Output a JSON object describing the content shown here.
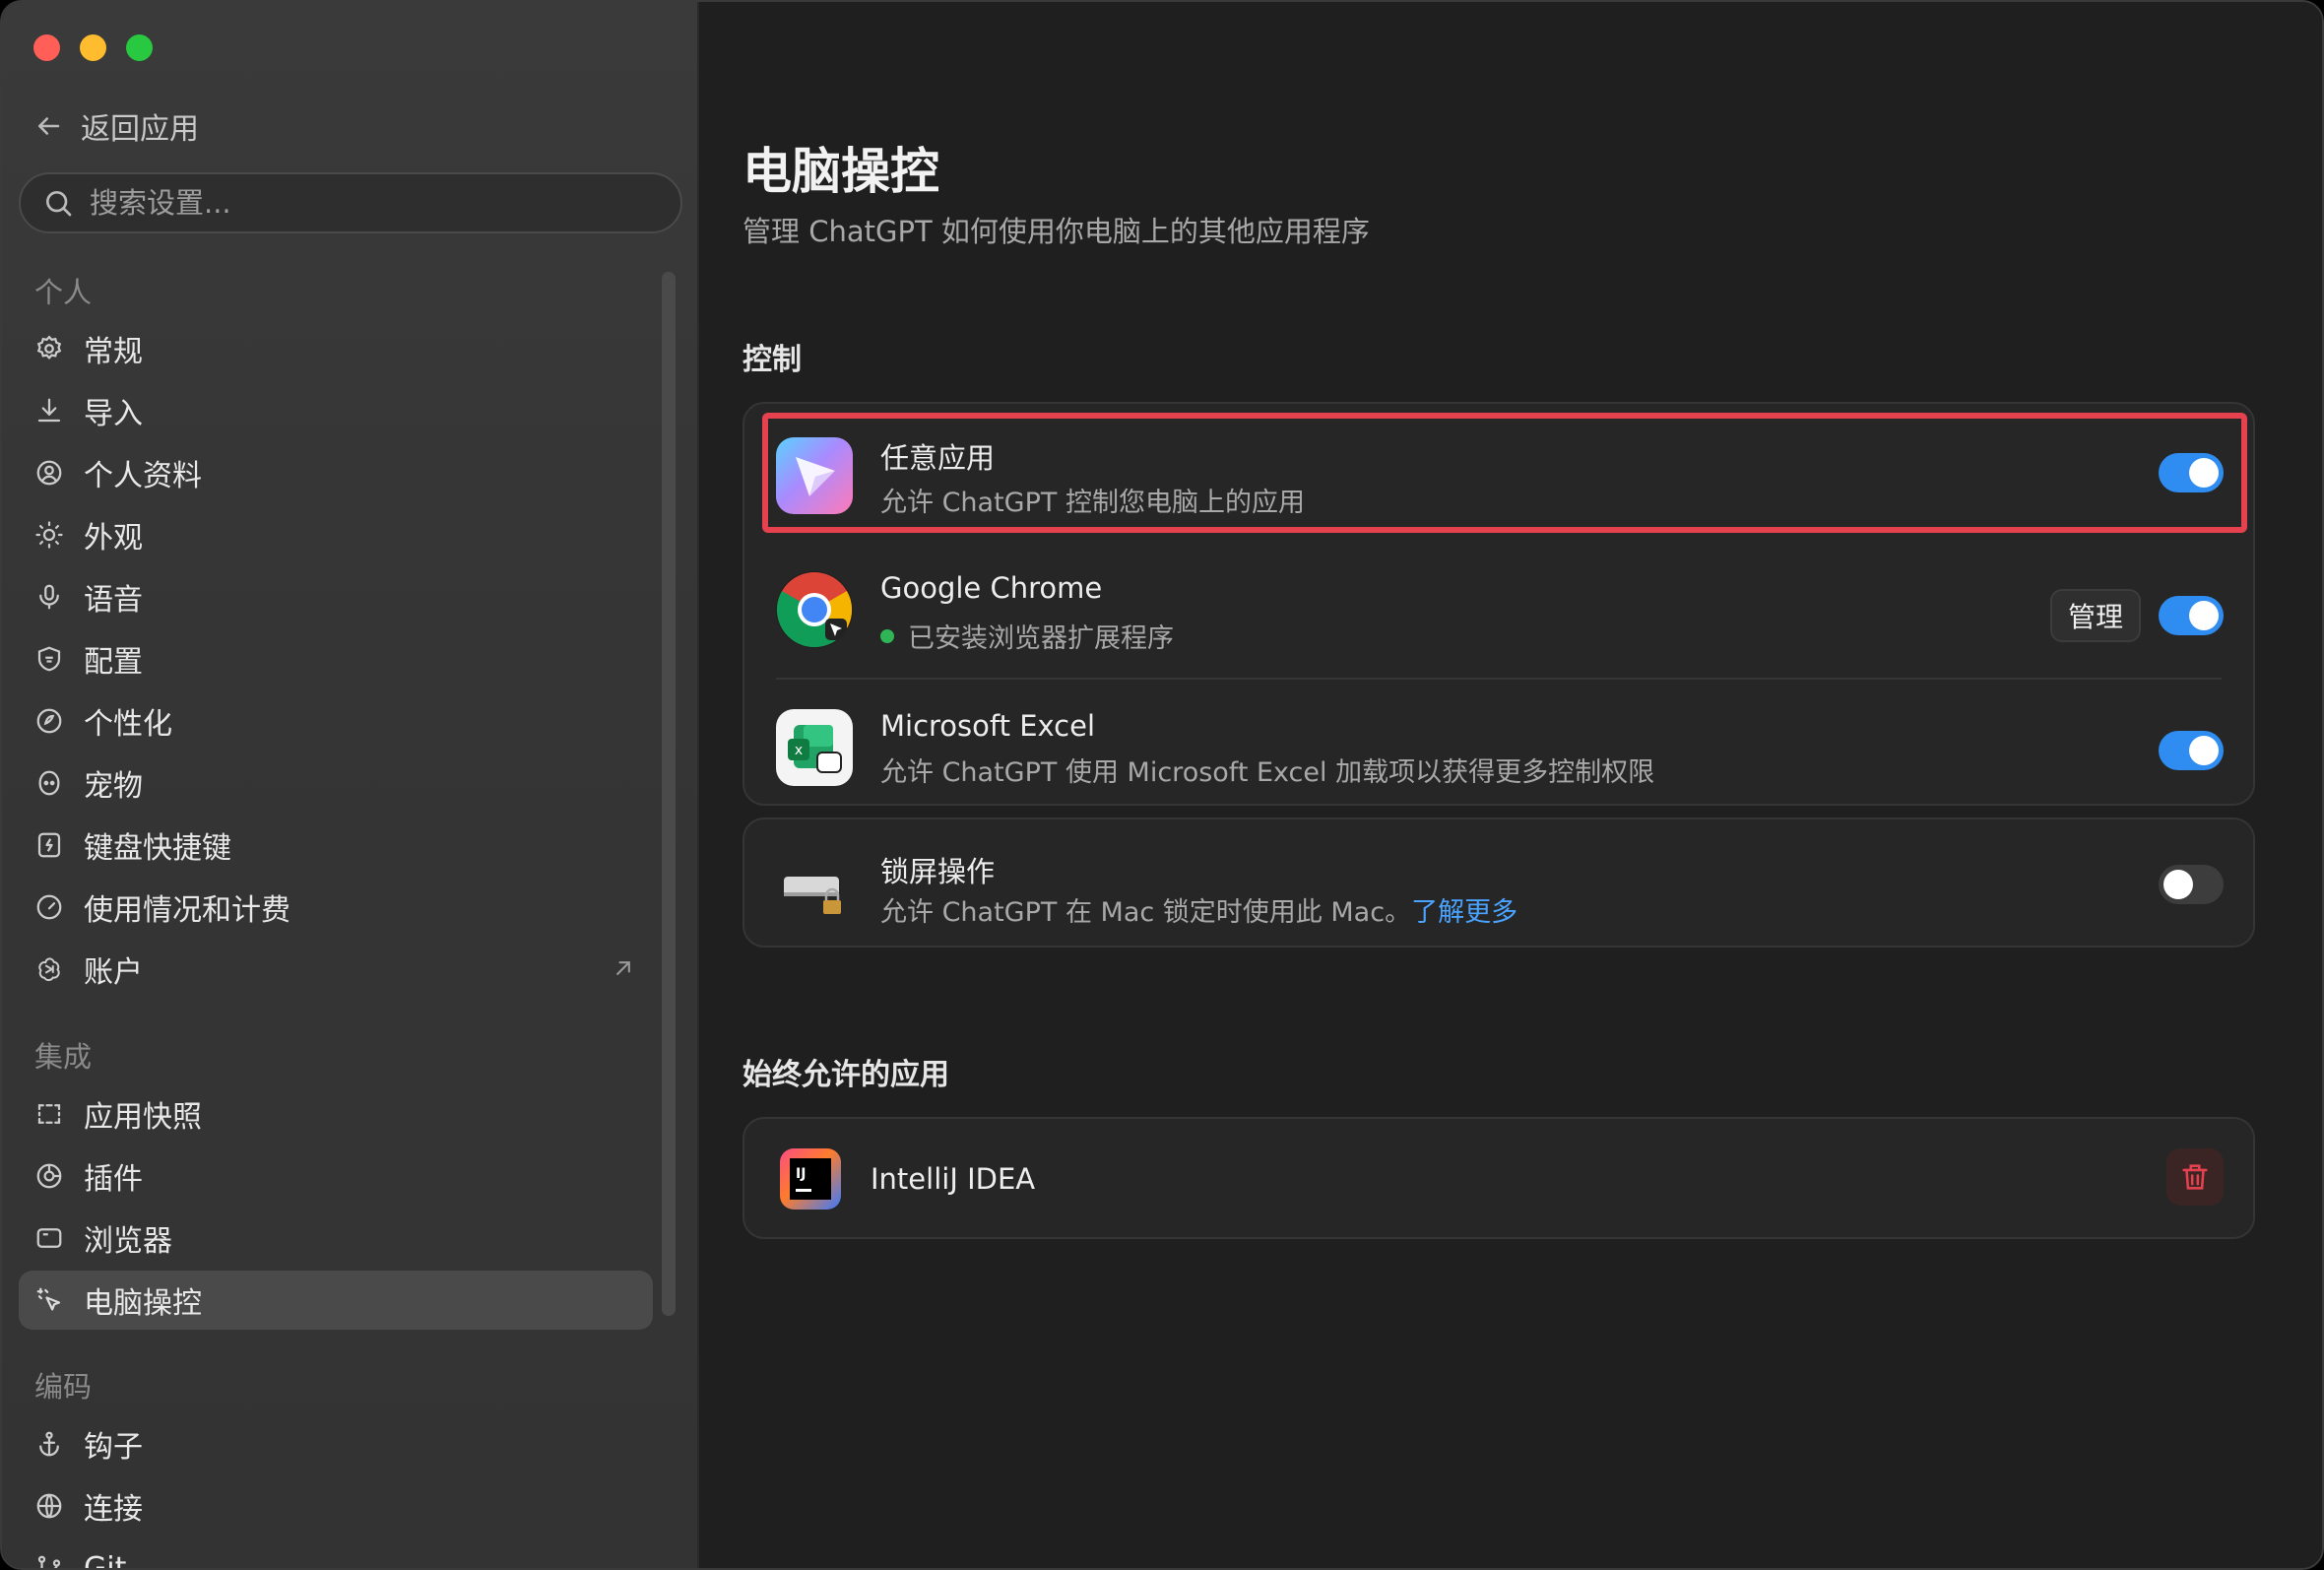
{
  "window": {
    "traffic_colors": [
      "#ff5f57",
      "#febc2e",
      "#28c840"
    ]
  },
  "sidebar": {
    "back_label": "返回应用",
    "search_placeholder": "搜索设置...",
    "sections": [
      {
        "label": "个人"
      },
      {
        "label": "集成"
      },
      {
        "label": "编码"
      }
    ],
    "items": [
      {
        "label": "常规",
        "icon": "gear-icon"
      },
      {
        "label": "导入",
        "icon": "download-icon"
      },
      {
        "label": "个人资料",
        "icon": "profile-icon"
      },
      {
        "label": "外观",
        "icon": "sun-icon"
      },
      {
        "label": "语音",
        "icon": "microphone-icon"
      },
      {
        "label": "配置",
        "icon": "shield-icon"
      },
      {
        "label": "个性化",
        "icon": "personalize-icon"
      },
      {
        "label": "宠物",
        "icon": "pet-icon"
      },
      {
        "label": "键盘快捷键",
        "icon": "keyboard-icon"
      },
      {
        "label": "使用情况和计费",
        "icon": "gauge-icon"
      },
      {
        "label": "账户",
        "icon": "openai-icon"
      },
      {
        "label": "应用快照",
        "icon": "snapshot-icon"
      },
      {
        "label": "插件",
        "icon": "plugin-icon"
      },
      {
        "label": "浏览器",
        "icon": "browser-icon"
      },
      {
        "label": "电脑操控",
        "icon": "cursor-icon"
      },
      {
        "label": "钩子",
        "icon": "anchor-icon"
      },
      {
        "label": "连接",
        "icon": "globe-icon"
      },
      {
        "label": "Git",
        "icon": "git-icon"
      }
    ]
  },
  "main": {
    "title": "电脑操控",
    "subtitle": "管理 ChatGPT 如何使用你电脑上的其他应用程序",
    "control_section": "控制",
    "apps": [
      {
        "name": "任意应用",
        "desc": "允许 ChatGPT 控制您电脑上的应用",
        "enabled": true
      },
      {
        "name": "Google Chrome",
        "desc": "已安装浏览器扩展程序",
        "manage_label": "管理",
        "enabled": true
      },
      {
        "name": "Microsoft Excel",
        "desc": "允许 ChatGPT 使用 Microsoft Excel 加载项以获得更多控制权限",
        "enabled": true
      }
    ],
    "lock_screen": {
      "name": "锁屏操作",
      "desc": "允许 ChatGPT 在 Mac 锁定时使用此 Mac。",
      "link": "了解更多",
      "enabled": false
    },
    "always_allowed_section": "始终允许的应用",
    "always_allowed": [
      {
        "name": "IntelliJ IDEA"
      }
    ],
    "accent_color": "#2f8cf0",
    "highlight_color": "#e5414f"
  }
}
